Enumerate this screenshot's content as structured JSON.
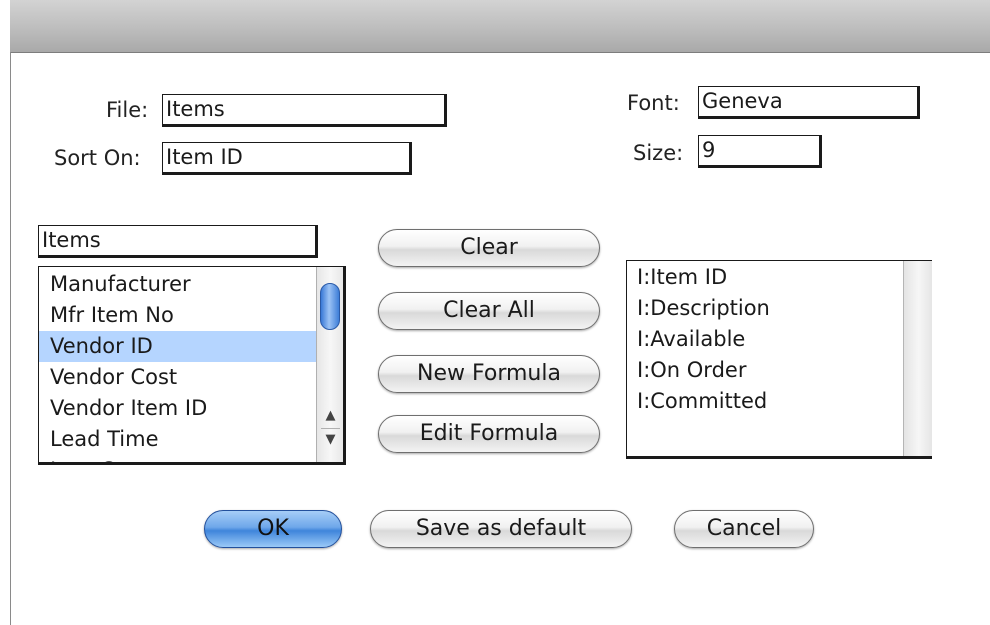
{
  "form": {
    "file_label": "File:",
    "file_value": "Items",
    "sort_label": "Sort On:",
    "sort_value": "Item ID",
    "font_label": "Font:",
    "font_value": "Geneva",
    "size_label": "Size:",
    "size_value": "9"
  },
  "source": {
    "table_value": "Items",
    "fields": [
      {
        "label": "Manufacturer",
        "selected": false
      },
      {
        "label": "Mfr Item No",
        "selected": false
      },
      {
        "label": "Vendor ID",
        "selected": true
      },
      {
        "label": "Vendor Cost",
        "selected": false
      },
      {
        "label": "Vendor Item ID",
        "selected": false
      },
      {
        "label": "Lead Time",
        "selected": false
      },
      {
        "label": "Last Cost",
        "selected": false
      }
    ],
    "scroll_up_icon": "arrow-up-icon",
    "scroll_down_icon": "arrow-down-icon"
  },
  "actions": {
    "clear": "Clear",
    "clear_all": "Clear All",
    "new_formula": "New Formula",
    "edit_formula": "Edit Formula"
  },
  "selected_fields": [
    "I:Item ID",
    "I:Description",
    "I:Available",
    "I:On Order",
    "I:Committed"
  ],
  "footer": {
    "ok": "OK",
    "save_default": "Save as default",
    "cancel": "Cancel"
  },
  "colors": {
    "selection": "#b5d5ff",
    "default_button": "#5b9be3"
  }
}
